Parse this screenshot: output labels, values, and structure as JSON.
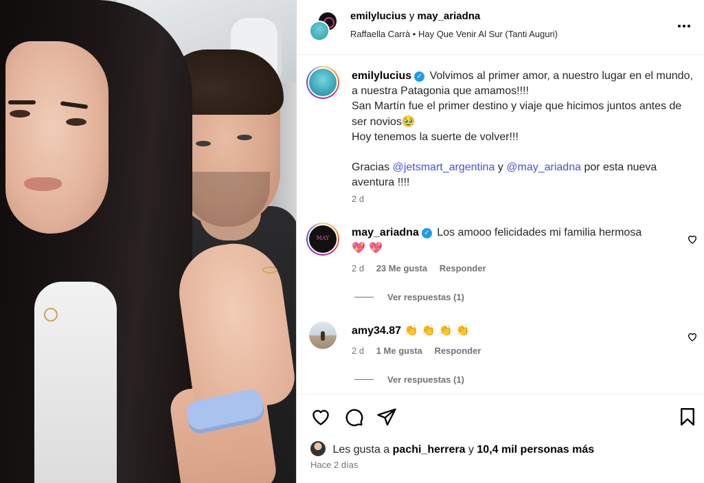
{
  "header": {
    "user1": "emilylucius",
    "joiner": "y",
    "user2": "may_ariadna",
    "music": "Raffaella Carrà • Hay Que Venir Al Sur (Tanti Auguri)",
    "more_icon": "more-horizontal-icon"
  },
  "caption": {
    "user": "emilylucius",
    "line1": "Volvimos al primer amor, a nuestro lugar en el mundo, a nuestra Patagonia que amamos!!!!",
    "line2": "San Martín fue el primer destino y viaje que hicimos juntos antes de ser novios",
    "line2_emoji": "🥹",
    "line3": "Hoy tenemos la suerte de volver!!!",
    "line4_pre": "Gracias",
    "mention1": "@jetsmart_argentina",
    "line4_mid": "y",
    "mention2": "@may_ariadna",
    "line4_post": "por esta nueva aventura !!!!",
    "time": "2 d"
  },
  "comments": [
    {
      "user": "may_ariadna",
      "text": "Los amooo felicidades mi familia hermosa",
      "emoji": "💖 💖",
      "time": "2 d",
      "likes": "23 Me gusta",
      "reply": "Responder",
      "view_replies": "Ver respuestas (1)"
    },
    {
      "user": "amy34.87",
      "emoji": "👏 👏 👏 👏",
      "time": "2 d",
      "likes": "1 Me gusta",
      "reply": "Responder",
      "view_replies": "Ver respuestas (1)"
    }
  ],
  "likes": {
    "prefix": "Les gusta a",
    "user": "pachi_herrera",
    "mid": "y",
    "count": "10,4 mil personas más"
  },
  "posted": "Hace 2 días",
  "colors": {
    "mention": "#4150f7",
    "verified": "#1d9bf0",
    "muted": "#737373"
  }
}
